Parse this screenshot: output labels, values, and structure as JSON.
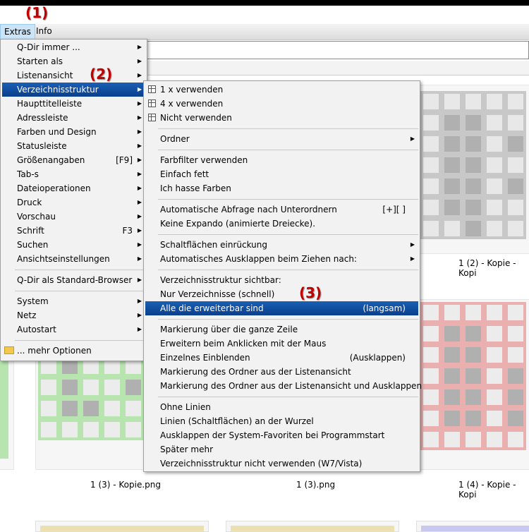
{
  "markers": [
    "(1)",
    "(2)",
    "(3)"
  ],
  "menubar": {
    "extras": "Extras",
    "info": "Info"
  },
  "main_menu": {
    "items": [
      {
        "label": "Q-Dir immer ...",
        "arrow": true
      },
      {
        "label": "Starten als",
        "arrow": true
      },
      {
        "label": "Listenansicht",
        "arrow": true
      },
      {
        "label": "Verzeichnisstruktur",
        "arrow": true,
        "highlight": true
      },
      {
        "label": "Haupttitelleiste",
        "arrow": true
      },
      {
        "label": "Adressleiste",
        "arrow": true
      },
      {
        "label": "Farben und Design",
        "arrow": true
      },
      {
        "label": "Statusleiste",
        "arrow": true
      },
      {
        "label": "Größenangaben",
        "shortcut": "[F9]",
        "arrow": true
      },
      {
        "label": "Tab-s",
        "arrow": true
      },
      {
        "label": "Dateioperationen",
        "arrow": true
      },
      {
        "label": "Druck",
        "arrow": true
      },
      {
        "label": "Vorschau",
        "arrow": true
      },
      {
        "label": "Schrift",
        "shortcut": "F3",
        "arrow": true
      },
      {
        "label": "Suchen",
        "arrow": true
      },
      {
        "label": "Ansichtseinstellungen",
        "arrow": true
      },
      {
        "sep": true
      },
      {
        "label": "Q-Dir als Standard-Browser",
        "arrow": true
      },
      {
        "sep": true
      },
      {
        "label": "System",
        "arrow": true
      },
      {
        "label": "Netz",
        "arrow": true
      },
      {
        "label": "Autostart",
        "arrow": true
      },
      {
        "sep": true
      },
      {
        "label": "... mehr Optionen",
        "icon": "folder-icon"
      }
    ]
  },
  "sub_menu": {
    "items": [
      {
        "label": "1 x verwenden",
        "icon": "grid-icon"
      },
      {
        "label": "4 x verwenden",
        "icon": "grid-icon"
      },
      {
        "label": "Nicht verwenden",
        "icon": "grid-icon"
      },
      {
        "sep": true
      },
      {
        "label": "Ordner",
        "arrow": true
      },
      {
        "sep": true
      },
      {
        "label": "Farbfilter verwenden"
      },
      {
        "label": "Einfach fett"
      },
      {
        "label": "Ich hasse Farben"
      },
      {
        "sep": true
      },
      {
        "label": "Automatische Abfrage nach Unterordnern",
        "shortcut": "[+][ ]"
      },
      {
        "label": "Keine Expando (animierte Dreiecke)."
      },
      {
        "sep": true
      },
      {
        "label": "Schaltflächen einrückung",
        "arrow": true
      },
      {
        "label": "Automatisches Ausklappen beim Ziehen nach:",
        "arrow": true
      },
      {
        "sep": true
      },
      {
        "label": "Verzeichnisstruktur sichtbar:"
      },
      {
        "label": "Nur Verzeichnisse (schnell)"
      },
      {
        "label": "Alle die erweiterbar sind",
        "shortcut": "(langsam)",
        "highlight": true
      },
      {
        "sep": true
      },
      {
        "label": "Markierung über die ganze Zeile"
      },
      {
        "label": "Erweitern beim Anklicken mit der Maus"
      },
      {
        "label": "Einzelnes Einblenden",
        "shortcut": "(Ausklappen)"
      },
      {
        "label": "Markierung des Ordner aus der Listenansicht"
      },
      {
        "label": "Markierung des Ordner aus der Listenansicht und Ausklappen"
      },
      {
        "sep": true
      },
      {
        "label": "Ohne Linien"
      },
      {
        "label": "Linien (Schaltflächen) an der Wurzel"
      },
      {
        "label": "Ausklappen der System-Favoriten bei Programmstart"
      },
      {
        "label": "Später mehr"
      },
      {
        "label": "Verzeichnisstruktur nicht verwenden (W7/Vista)"
      }
    ]
  },
  "files": {
    "caption_1": "1 (2) - Kopie - Kopi",
    "caption_2": "1 (3) - Kopie.png",
    "caption_3": "1 (3).png",
    "caption_4": "1 (4) - Kopie - Kopi"
  },
  "colors": {
    "highlight": "#0a4a9c",
    "marker": "#c00000",
    "green": "#b8e4b0",
    "gray": "#c8c8c8",
    "red": "#eab0b0",
    "beige": "#ece0b0",
    "lavender": "#c8c8f0"
  }
}
